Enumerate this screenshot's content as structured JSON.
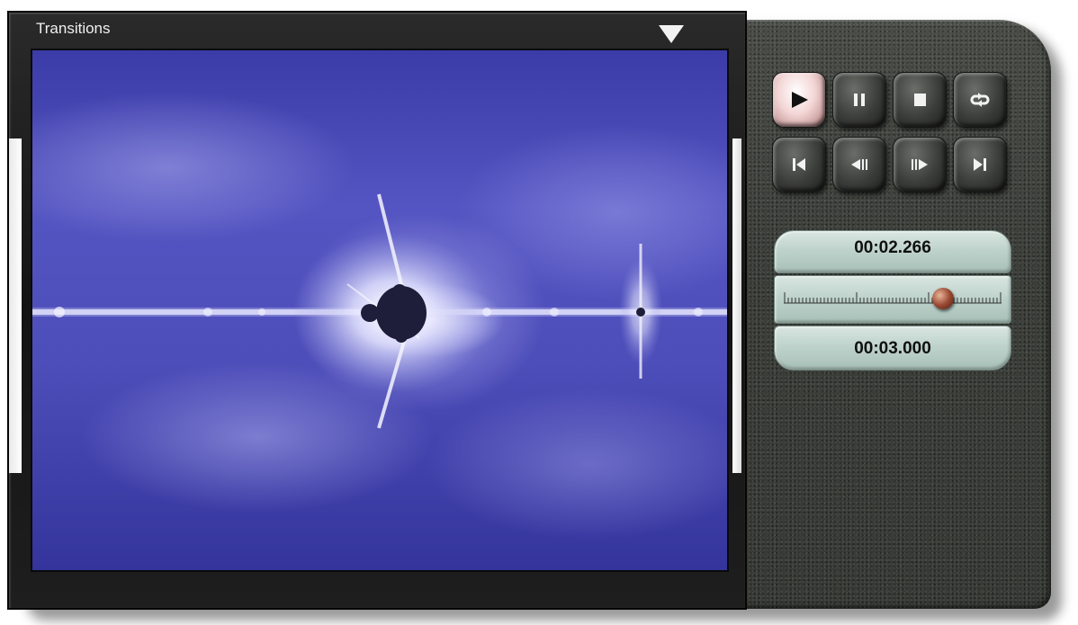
{
  "window": {
    "title": "Transitions"
  },
  "transport": {
    "buttons": [
      {
        "name": "play",
        "icon": "play-icon",
        "active": true
      },
      {
        "name": "pause",
        "icon": "pause-icon",
        "active": false
      },
      {
        "name": "stop",
        "icon": "stop-icon",
        "active": false
      },
      {
        "name": "loop",
        "icon": "loop-icon",
        "active": false
      },
      {
        "name": "go-to-start",
        "icon": "skip-start-icon",
        "active": false
      },
      {
        "name": "step-back",
        "icon": "step-back-icon",
        "active": false
      },
      {
        "name": "step-forward",
        "icon": "step-forward-icon",
        "active": false
      },
      {
        "name": "go-to-end",
        "icon": "skip-end-icon",
        "active": false
      }
    ]
  },
  "playback": {
    "current_time": "00:02.266",
    "total_time": "00:03.000",
    "position_fraction": 0.755
  },
  "colors": {
    "screen_blue": "#4e4eba",
    "panel": "#3d403b",
    "display_green": "#bcd1ca",
    "knob": "#9a4a34"
  }
}
